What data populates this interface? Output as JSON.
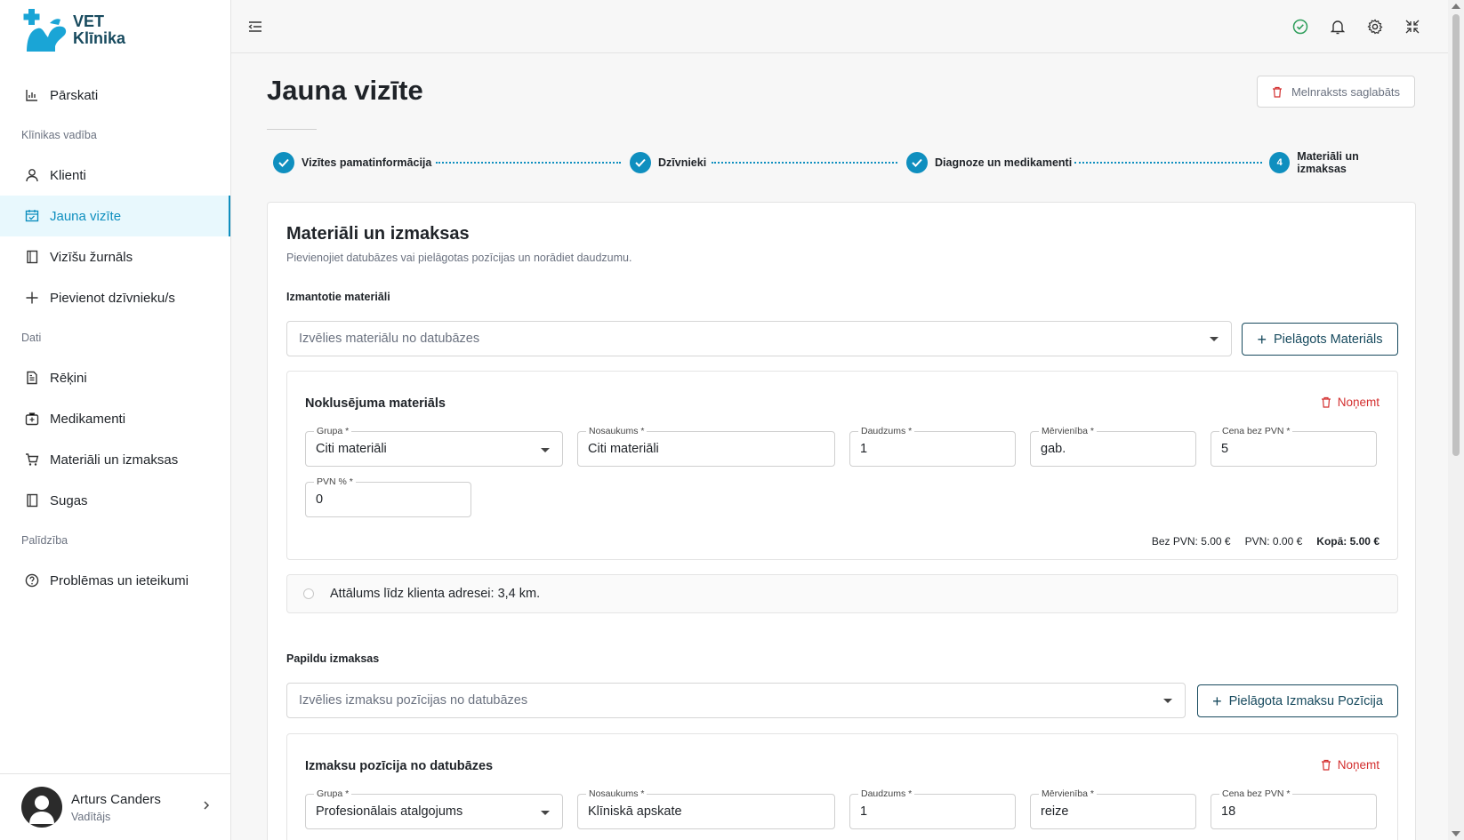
{
  "logo": {
    "line1": "VET",
    "line2": "Klīnika"
  },
  "sidebar": {
    "items": [
      {
        "label": "Pārskati",
        "icon": "chart-icon"
      },
      {
        "section": "Klīnikas vadība"
      },
      {
        "label": "Klienti",
        "icon": "user-icon"
      },
      {
        "label": "Jauna vizīte",
        "icon": "calendar-icon",
        "active": true
      },
      {
        "label": "Vizīšu žurnāls",
        "icon": "book-icon"
      },
      {
        "label": "Pievienot dzīvnieku/s",
        "icon": "plus-icon"
      },
      {
        "section": "Dati"
      },
      {
        "label": "Rēķini",
        "icon": "invoice-icon"
      },
      {
        "label": "Medikamenti",
        "icon": "medkit-icon"
      },
      {
        "label": "Materiāli un izmaksas",
        "icon": "cart-icon"
      },
      {
        "label": "Sugas",
        "icon": "book-icon"
      },
      {
        "section": "Palīdzība"
      },
      {
        "label": "Problēmas un ieteikumi",
        "icon": "help-icon"
      }
    ],
    "user": {
      "name": "Arturs Canders",
      "role": "Vadītājs"
    }
  },
  "page": {
    "title": "Jauna vizīte",
    "draft_button": "Melnraksts saglabāts"
  },
  "stepper": {
    "steps": [
      {
        "label": "Vizītes pamatinformācija",
        "done": true
      },
      {
        "label": "Dzīvnieki",
        "done": true
      },
      {
        "label": "Diagnoze un medikamenti",
        "done": true
      },
      {
        "label": "Materiāli un izmaksas",
        "number": "4",
        "done": false
      }
    ]
  },
  "card": {
    "title": "Materiāli un izmaksas",
    "subtitle": "Pievienojiet datubāzes vai pielāgotas pozīcijas un norādiet daudzumu.",
    "materials": {
      "label": "Izmantotie materiāli",
      "select_placeholder": "Izvēlies materiālu no datubāzes",
      "custom_button": "Pielāgots Materiāls",
      "item": {
        "title": "Noklusējuma materiāls",
        "remove": "Noņemt",
        "fields": {
          "group": {
            "label": "Grupa *",
            "value": "Citi materiāli"
          },
          "name": {
            "label": "Nosaukums *",
            "value": "Citi materiāli"
          },
          "qty": {
            "label": "Daudzums *",
            "value": "1"
          },
          "unit": {
            "label": "Mērvienība *",
            "value": "gab."
          },
          "price": {
            "label": "Cena bez PVN *",
            "value": "5"
          },
          "vat": {
            "label": "PVN % *",
            "value": "0"
          }
        },
        "totals": {
          "net": "Bez PVN: 5.00 €",
          "vat": "PVN: 0.00 €",
          "total": "Kopā: 5.00 €"
        }
      }
    },
    "distance": "Attālums līdz klienta adresei: 3,4 km.",
    "costs": {
      "label": "Papildu izmaksas",
      "select_placeholder": "Izvēlies izmaksu pozīcijas no datubāzes",
      "custom_button": "Pielāgota Izmaksu Pozīcija",
      "item": {
        "title": "Izmaksu pozīcija no datubāzes",
        "remove": "Noņemt",
        "fields": {
          "group": {
            "label": "Grupa *",
            "value": "Profesionālais atalgojums"
          },
          "name": {
            "label": "Nosaukums *",
            "value": "Klīniskā apskate"
          },
          "qty": {
            "label": "Daudzums *",
            "value": "1"
          },
          "unit": {
            "label": "Mērvienība *",
            "value": "reize"
          },
          "price": {
            "label": "Cena bez PVN *",
            "value": "18"
          }
        }
      }
    }
  },
  "colors": {
    "accent": "#0f8fbf",
    "brand": "#174a5e",
    "danger": "#d32f2f",
    "success": "#2e9e5b"
  }
}
